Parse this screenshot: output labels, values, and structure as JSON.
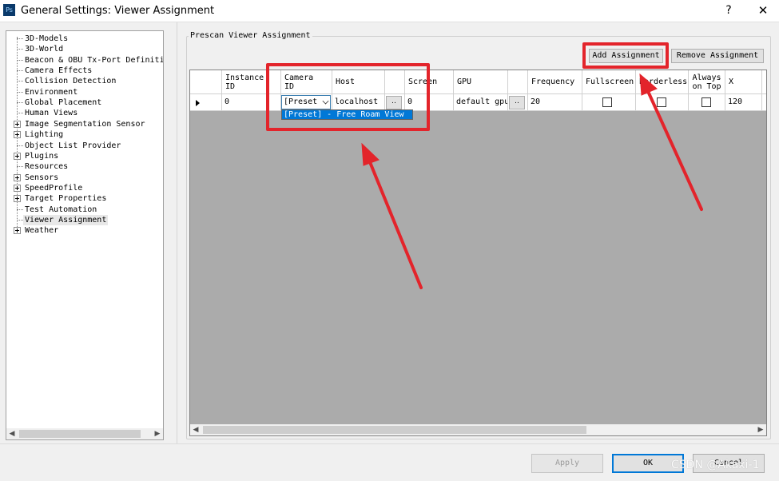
{
  "window": {
    "icon_text": "Ps",
    "title": "General Settings: Viewer Assignment",
    "help": "?",
    "close": "✕"
  },
  "tree": {
    "items": [
      {
        "label": "3D-Models",
        "expandable": false
      },
      {
        "label": "3D-World",
        "expandable": false
      },
      {
        "label": "Beacon & OBU Tx-Port Definitio",
        "expandable": false
      },
      {
        "label": "Camera Effects",
        "expandable": false
      },
      {
        "label": "Collision Detection",
        "expandable": false
      },
      {
        "label": "Environment",
        "expandable": false
      },
      {
        "label": "Global Placement",
        "expandable": false
      },
      {
        "label": "Human Views",
        "expandable": false
      },
      {
        "label": "Image Segmentation Sensor",
        "expandable": true
      },
      {
        "label": "Lighting",
        "expandable": true
      },
      {
        "label": "Object List Provider",
        "expandable": false
      },
      {
        "label": "Plugins",
        "expandable": true
      },
      {
        "label": "Resources",
        "expandable": false
      },
      {
        "label": "Sensors",
        "expandable": true
      },
      {
        "label": "SpeedProfile",
        "expandable": true
      },
      {
        "label": "Target Properties",
        "expandable": true
      },
      {
        "label": "Test Automation",
        "expandable": false
      },
      {
        "label": "Viewer Assignment",
        "expandable": false,
        "selected": true
      },
      {
        "label": "Weather",
        "expandable": true
      }
    ]
  },
  "group": {
    "title": "Prescan Viewer Assignment"
  },
  "toolbar": {
    "add_label": "Add Assignment",
    "remove_label": "Remove Assignment"
  },
  "grid": {
    "columns": [
      "Instance\nID",
      "Camera\nID",
      "Host",
      "",
      "Screen",
      "GPU",
      "",
      "Frequency",
      "Fullscreen",
      "Borderless",
      "Always\non Top",
      "X",
      ""
    ],
    "row": {
      "instance_id": "0",
      "camera_id": "[Preset",
      "host": "localhost",
      "host_browse": "..",
      "screen": "0",
      "gpu": "default gpu",
      "gpu_browse": "..",
      "frequency": "20",
      "fullscreen": false,
      "borderless": false,
      "always_on_top": false,
      "x": "120"
    },
    "dropdown_option": "[Preset] - Free Roam View"
  },
  "footer": {
    "apply": "Apply",
    "ok": "OK",
    "cancel": "Cancel"
  },
  "watermark": "CSDN @Akaxi-1",
  "annotation_color": "#e3242b"
}
